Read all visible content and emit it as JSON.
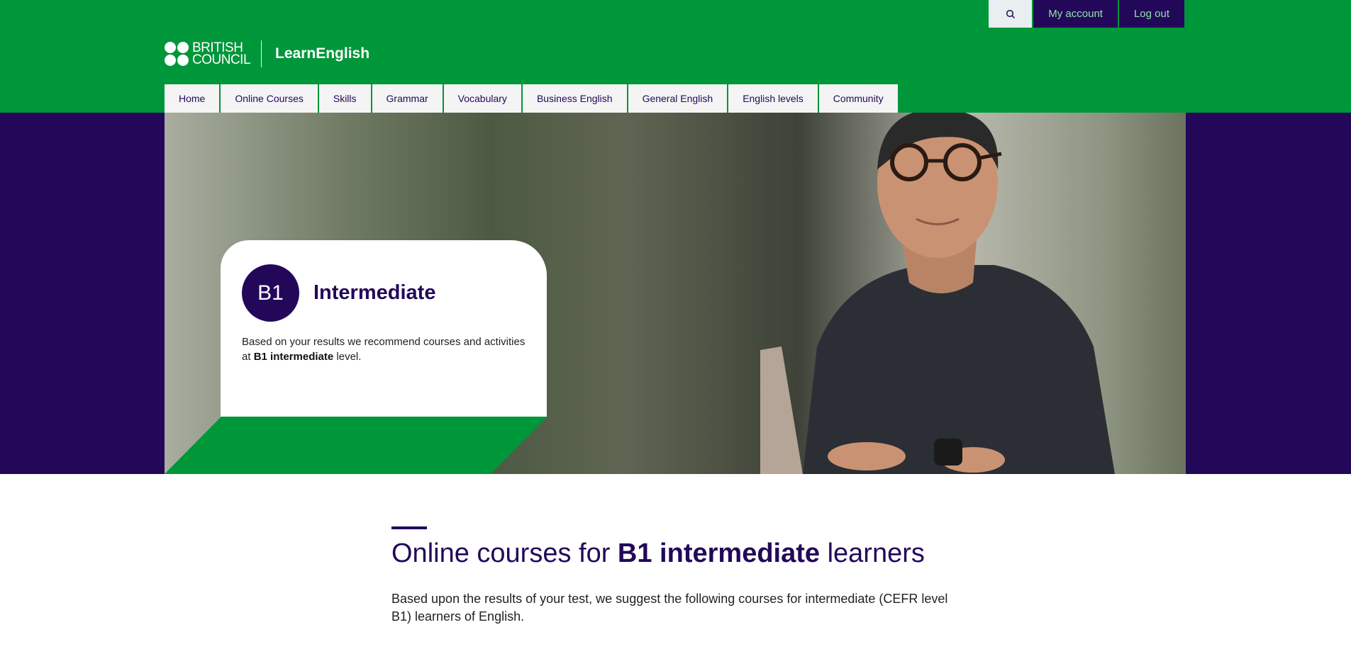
{
  "util": {
    "search_icon": "search-icon",
    "my_account": "My account",
    "log_out": "Log out"
  },
  "logo": {
    "line1": "BRITISH",
    "line2": "COUNCIL",
    "product": "LearnEnglish"
  },
  "nav": {
    "items": [
      {
        "label": "Home"
      },
      {
        "label": "Online Courses"
      },
      {
        "label": "Skills"
      },
      {
        "label": "Grammar"
      },
      {
        "label": "Vocabulary"
      },
      {
        "label": "Business English"
      },
      {
        "label": "General English"
      },
      {
        "label": "English levels"
      },
      {
        "label": "Community"
      }
    ]
  },
  "hero": {
    "badge": "B1",
    "title": "Intermediate",
    "text_before": "Based on your results we recommend courses and activities at ",
    "text_bold": "B1 intermediate",
    "text_after": " level."
  },
  "content": {
    "title_before": "Online courses for ",
    "title_bold": "B1 intermediate",
    "title_after": " learners",
    "intro": "Based upon the results of your test, we suggest the following courses for intermediate (CEFR level B1) learners of English."
  },
  "colors": {
    "brand_green": "#00963a",
    "brand_purple": "#23085a",
    "accent_text": "#8fe3a7"
  }
}
